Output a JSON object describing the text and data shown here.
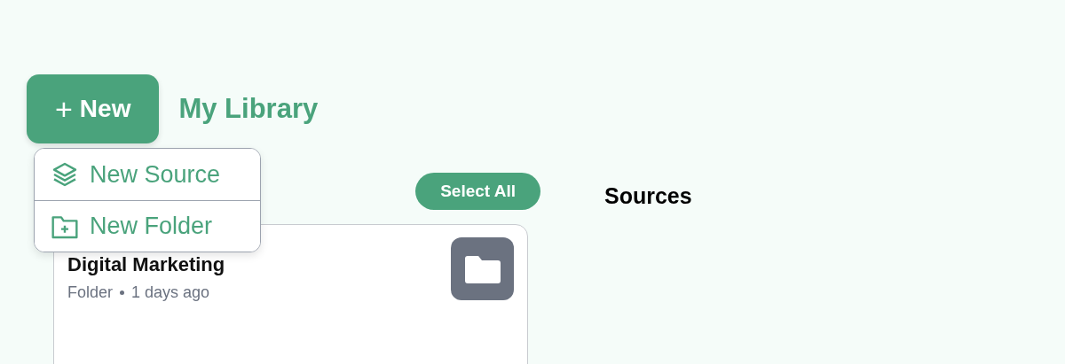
{
  "new_button": {
    "icon": "+",
    "label": "New"
  },
  "page_title": "My Library",
  "new_menu": {
    "items": [
      {
        "kind": "source",
        "label": "New Source"
      },
      {
        "kind": "folder",
        "label": "New Folder"
      }
    ]
  },
  "select_all_button": "Select All",
  "sources_heading": "Sources",
  "cards": [
    {
      "kind": "folder",
      "title": "Digital Marketing",
      "type": "Folder",
      "age": "1 days ago"
    }
  ]
}
